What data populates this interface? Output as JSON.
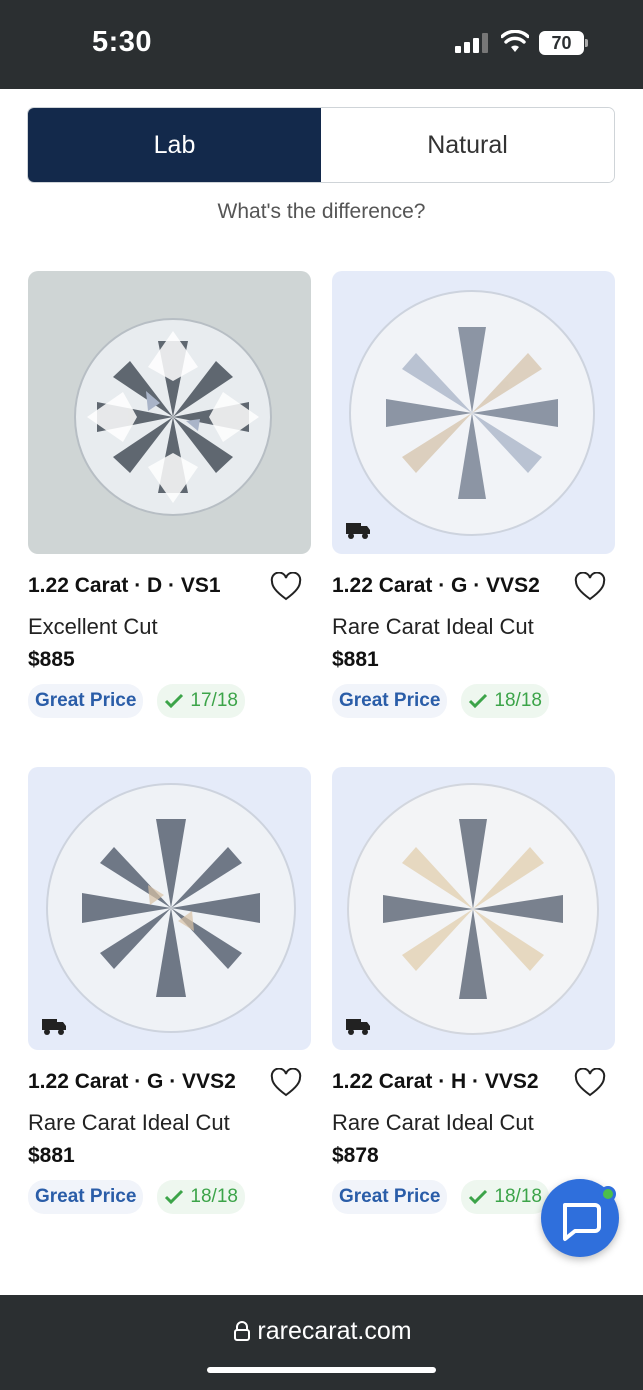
{
  "status_bar": {
    "time": "5:30",
    "battery": "70"
  },
  "toggle": {
    "lab_label": "Lab",
    "natural_label": "Natural"
  },
  "difference_link": "What's the difference?",
  "products": [
    {
      "title": "1.22 Carat · D · VS1",
      "cut": "Excellent Cut",
      "price": "$885",
      "price_badge": "Great Price",
      "score": "17/18"
    },
    {
      "title": "1.22 Carat · G · VVS2",
      "cut": "Rare Carat Ideal Cut",
      "price": "$881",
      "price_badge": "Great Price",
      "score": "18/18"
    },
    {
      "title": "1.22 Carat · G · VVS2",
      "cut": "Rare Carat Ideal Cut",
      "price": "$881",
      "price_badge": "Great Price",
      "score": "18/18"
    },
    {
      "title": "1.22 Carat · H · VVS2",
      "cut": "Rare Carat Ideal Cut",
      "price": "$878",
      "price_badge": "Great Price",
      "score": "18/18"
    }
  ],
  "browser": {
    "url": "rarecarat.com"
  },
  "colors": {
    "navy": "#13294b",
    "great_price": "#2a5da8",
    "score_green": "#3ca449",
    "chat_blue": "#2f6fdc"
  },
  "icons": [
    "signal-icon",
    "wifi-icon",
    "battery-icon",
    "heart-icon",
    "truck-icon",
    "check-icon",
    "chat-icon",
    "lock-icon"
  ]
}
